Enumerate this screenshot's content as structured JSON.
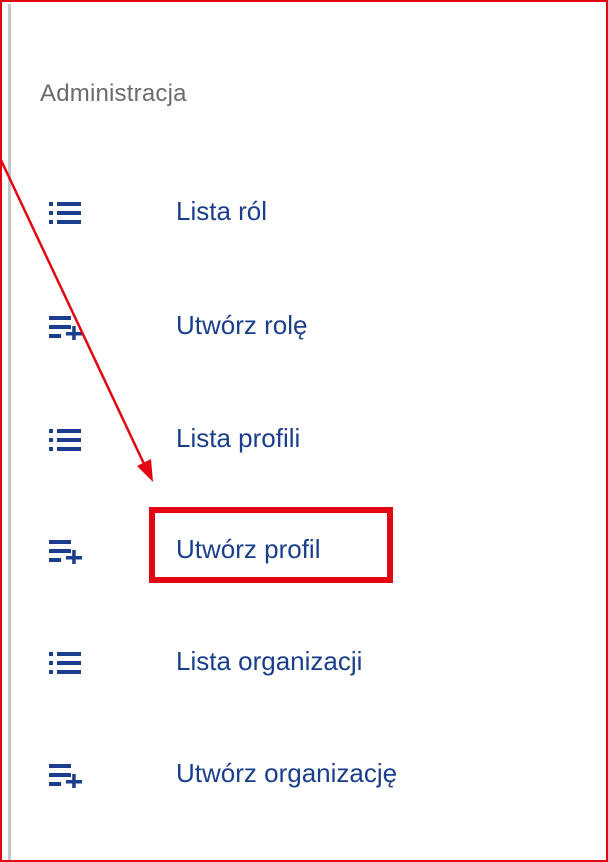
{
  "section": {
    "title": "Administracja"
  },
  "menu": {
    "items": [
      {
        "label": "Lista ról",
        "icon": "list-icon"
      },
      {
        "label": "Utwórz rolę",
        "icon": "playlist-add-icon"
      },
      {
        "label": "Lista profili",
        "icon": "list-icon"
      },
      {
        "label": "Utwórz profil",
        "icon": "playlist-add-icon",
        "highlighted": true
      },
      {
        "label": "Lista organizacji",
        "icon": "list-icon"
      },
      {
        "label": "Utwórz organizację",
        "icon": "playlist-add-icon"
      }
    ]
  },
  "colors": {
    "accent": "#e30613",
    "link": "#1a3e8c",
    "muted": "#6b6b6b"
  }
}
